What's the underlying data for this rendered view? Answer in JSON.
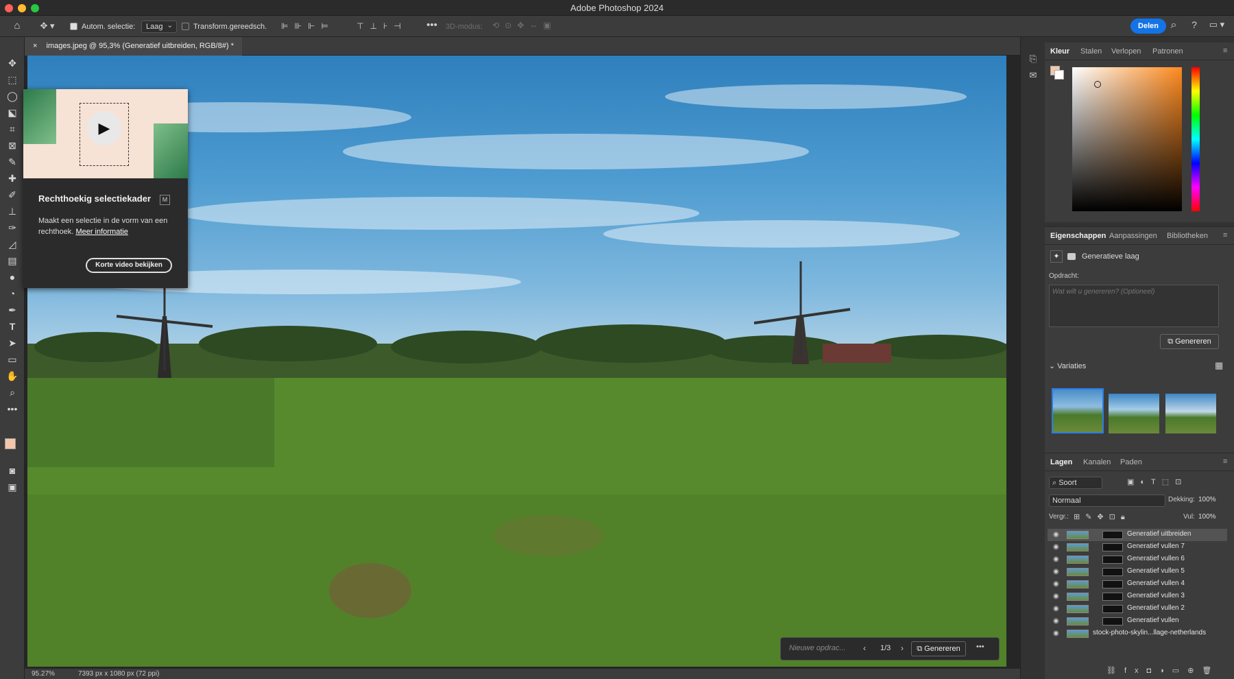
{
  "app": {
    "title": "Adobe Photoshop 2024"
  },
  "options": {
    "auto_select_label": "Autom. selectie:",
    "auto_select_value": "Laag",
    "transform_label": "Transform.gereedsch.",
    "mode_3d_label": "3D-modus:",
    "share_label": "Delen"
  },
  "document": {
    "tab_title": "images.jpeg @ 95,3% (Generatief uitbreiden, RGB/8#) *"
  },
  "status": {
    "zoom": "95.27%",
    "size": "7393 px x 1080 px (72 ppi)"
  },
  "tooltip": {
    "title": "Rechthoekig selectiekader",
    "shortcut": "M",
    "description": "Maakt een selectie in de vorm van een rechthoek.",
    "link": "Meer informatie",
    "button": "Korte video bekijken"
  },
  "gen_bar": {
    "placeholder": "Nieuwe opdrac...",
    "counter": "1/3",
    "generate": "Genereren"
  },
  "color_panel": {
    "tabs": [
      "Kleur",
      "Stalen",
      "Verlopen",
      "Patronen"
    ],
    "foreground": "#f3c8aa",
    "background": "#ffffff",
    "hue_color": "#ff8a1e"
  },
  "properties": {
    "tabs": [
      "Eigenschappen",
      "Aanpassingen",
      "Bibliotheken"
    ],
    "layer_type": "Generatieve laag",
    "prompt_label": "Opdracht:",
    "prompt_placeholder": "Wat wilt u genereren? (Optioneel)",
    "generate": "Genereren",
    "variations_label": "Variaties"
  },
  "layers_panel": {
    "tabs": [
      "Lagen",
      "Kanalen",
      "Paden"
    ],
    "filter": "Soort",
    "blend_mode": "Normaal",
    "opacity_label": "Dekking:",
    "opacity": "100%",
    "lock_label": "Vergr.:",
    "fill_label": "Vul:",
    "fill": "100%",
    "layers": [
      "Generatief uitbreiden",
      "Generatief vullen 7",
      "Generatief vullen 6",
      "Generatief vullen 5",
      "Generatief vullen 4",
      "Generatief vullen 3",
      "Generatief vullen 2",
      "Generatief vullen",
      "stock-photo-skylin...llage-netherlands"
    ]
  }
}
